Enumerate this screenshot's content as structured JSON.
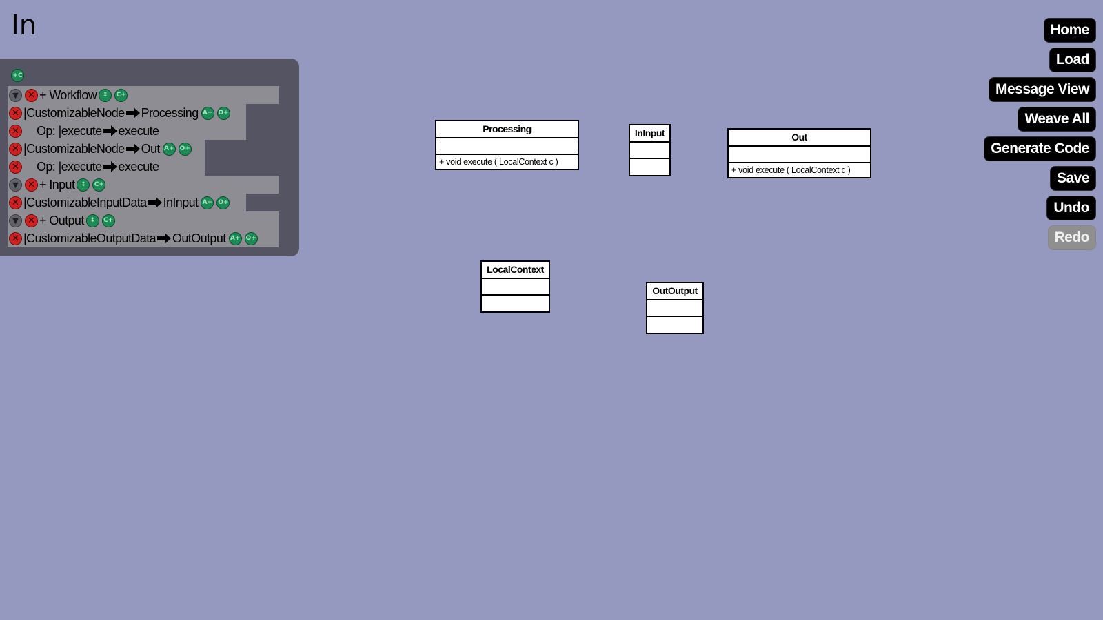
{
  "page_title": "In",
  "menu": {
    "home": "Home",
    "load": "Load",
    "message_view": "Message View",
    "weave_all": "Weave All",
    "generate_code": "Generate Code",
    "save": "Save",
    "undo": "Undo",
    "redo": "Redo"
  },
  "icons": {
    "collapse": "▼",
    "delete": "✕",
    "add_attr": "A+",
    "add_op": "O+",
    "add_class": "C+",
    "move": "↕",
    "add_top": "+C"
  },
  "tree": {
    "workflow": {
      "label": "+ Workflow"
    },
    "processing_node": {
      "source": "|CustomizableNode",
      "target": "Processing"
    },
    "processing_op": {
      "source": "Op: |execute",
      "target": "execute"
    },
    "out_node": {
      "source": "|CustomizableNode",
      "target": "Out"
    },
    "out_op": {
      "source": "Op: |execute",
      "target": "execute"
    },
    "input": {
      "label": "+ Input"
    },
    "input_data": {
      "source": "|CustomizableInputData",
      "target": "InInput"
    },
    "output": {
      "label": "+ Output"
    },
    "output_data": {
      "source": "|CustomizableOutputData",
      "target": "OutOutput"
    }
  },
  "uml": {
    "processing": {
      "name": "Processing",
      "operation": "+ void  execute ( LocalContext  c )"
    },
    "ininput": {
      "name": "InInput"
    },
    "out": {
      "name": "Out",
      "operation": "+ void  execute ( LocalContext  c )"
    },
    "localcontext": {
      "name": "LocalContext"
    },
    "outoutput": {
      "name": "OutOutput"
    }
  },
  "colors": {
    "background": "#9598bf",
    "panel": "#545462",
    "row": "#8d8d93",
    "delete_icon": "#cc2222",
    "action_icon": "#1e8a56",
    "button": "#000000",
    "button_disabled": "#8f8f8f"
  }
}
